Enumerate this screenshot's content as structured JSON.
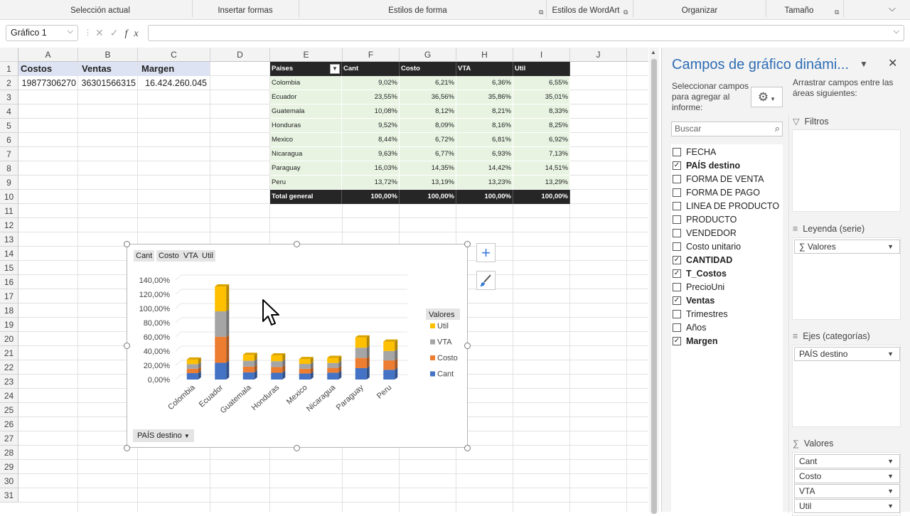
{
  "ribbon": {
    "groups": [
      "Selección actual",
      "Insertar formas",
      "Estilos de forma",
      "Estilos de WordArt",
      "Organizar",
      "Tamaño"
    ],
    "collapse_icon": "chevron-down-icon"
  },
  "formula_bar": {
    "name_box": "Gráfico 1",
    "fx_label": "fx",
    "formula": ""
  },
  "sheet": {
    "columns": [
      "A",
      "B",
      "C",
      "D",
      "E",
      "F",
      "G",
      "H",
      "I",
      "J"
    ],
    "rows": [
      "1",
      "2",
      "3",
      "4",
      "5",
      "6",
      "7",
      "8",
      "9",
      "10",
      "11",
      "12",
      "13",
      "14",
      "15",
      "16",
      "17",
      "18",
      "19",
      "20",
      "21",
      "22",
      "23",
      "24",
      "25",
      "26",
      "27",
      "28",
      "29",
      "30",
      "31"
    ],
    "a1": "Costos",
    "b1": "Ventas",
    "c1": "Margen",
    "a2": "19877306270",
    "b2": "36301566315",
    "c2": "16.424.260.045"
  },
  "pivot": {
    "headers": [
      "Paises",
      "Cant",
      "Costo",
      "VTA",
      "Util"
    ],
    "rows": [
      {
        "pais": "Colombia",
        "cant": "9,02%",
        "costo": "6,21%",
        "vta": "6,36%",
        "util": "6,55%"
      },
      {
        "pais": "Ecuador",
        "cant": "23,55%",
        "costo": "36,56%",
        "vta": "35,86%",
        "util": "35,01%"
      },
      {
        "pais": "Guatemala",
        "cant": "10,08%",
        "costo": "8,12%",
        "vta": "8,21%",
        "util": "8,33%"
      },
      {
        "pais": "Honduras",
        "cant": "9,52%",
        "costo": "8,09%",
        "vta": "8,16%",
        "util": "8,25%"
      },
      {
        "pais": "Mexico",
        "cant": "8,44%",
        "costo": "6,72%",
        "vta": "6,81%",
        "util": "6,92%"
      },
      {
        "pais": "Nicaragua",
        "cant": "9,63%",
        "costo": "6,77%",
        "vta": "6,93%",
        "util": "7,13%"
      },
      {
        "pais": "Paraguay",
        "cant": "16,03%",
        "costo": "14,35%",
        "vta": "14,42%",
        "util": "14,51%"
      },
      {
        "pais": "Peru",
        "cant": "13,72%",
        "costo": "13,19%",
        "vta": "13,23%",
        "util": "13,29%"
      }
    ],
    "total": {
      "pais": "Total general",
      "cant": "100,00%",
      "costo": "100,00%",
      "vta": "100,00%",
      "util": "100,00%"
    }
  },
  "chart": {
    "value_buttons": [
      "Cant",
      "Costo",
      "VTA",
      "Util"
    ],
    "axis_button": "PAÍS destino",
    "legend_title": "Valores",
    "plus_icon": "plus-icon",
    "brush_icon": "brush-icon"
  },
  "chart_data": {
    "type": "bar",
    "stacked": true,
    "categories": [
      "Colombia",
      "Ecuador",
      "Guatemala",
      "Honduras",
      "Mexico",
      "Nicaragua",
      "Paraguay",
      "Peru"
    ],
    "series": [
      {
        "name": "Cant",
        "color": "#4472c4",
        "values": [
          9.02,
          23.55,
          10.08,
          9.52,
          8.44,
          9.63,
          16.03,
          13.72
        ]
      },
      {
        "name": "Costo",
        "color": "#ed7d31",
        "values": [
          6.21,
          36.56,
          8.12,
          8.09,
          6.72,
          6.77,
          14.35,
          13.19
        ]
      },
      {
        "name": "VTA",
        "color": "#a5a5a5",
        "values": [
          6.36,
          35.86,
          8.21,
          8.16,
          6.81,
          6.93,
          14.42,
          13.23
        ]
      },
      {
        "name": "Util",
        "color": "#ffc000",
        "values": [
          6.55,
          35.01,
          8.33,
          8.25,
          6.92,
          7.13,
          14.51,
          13.29
        ]
      }
    ],
    "y_ticks": [
      "0,00%",
      "20,00%",
      "40,00%",
      "60,00%",
      "80,00%",
      "100,00%",
      "120,00%",
      "140,00%"
    ],
    "ylim": [
      0,
      140
    ],
    "legend_position": "right"
  },
  "pane": {
    "title": "Campos de gráfico dinámi...",
    "select_label": "Seleccionar campos para agregar al informe:",
    "drag_label": "Arrastrar campos entre las áreas siguientes:",
    "search_placeholder": "Buscar",
    "fields": [
      {
        "label": "FECHA",
        "checked": false
      },
      {
        "label": "PAÍS destino",
        "checked": true
      },
      {
        "label": "FORMA DE VENTA",
        "checked": false
      },
      {
        "label": "FORMA DE PAGO",
        "checked": false
      },
      {
        "label": "LINEA DE PRODUCTO",
        "checked": false
      },
      {
        "label": "PRODUCTO",
        "checked": false
      },
      {
        "label": "VENDEDOR",
        "checked": false
      },
      {
        "label": "Costo unitario",
        "checked": false
      },
      {
        "label": "CANTIDAD",
        "checked": true
      },
      {
        "label": "T_Costos",
        "checked": true
      },
      {
        "label": "PrecioUni",
        "checked": false
      },
      {
        "label": "Ventas",
        "checked": true
      },
      {
        "label": "Trimestres",
        "checked": false
      },
      {
        "label": "Años",
        "checked": false
      },
      {
        "label": "Margen",
        "checked": true
      }
    ],
    "areas": {
      "filters": "Filtros",
      "legend": "Leyenda (serie)",
      "legend_items": [
        "Valores"
      ],
      "axis": "Ejes (categorías)",
      "axis_items": [
        "PAÍS destino"
      ],
      "values": "Valores",
      "value_items": [
        "Cant",
        "Costo",
        "VTA",
        "Util"
      ]
    }
  }
}
